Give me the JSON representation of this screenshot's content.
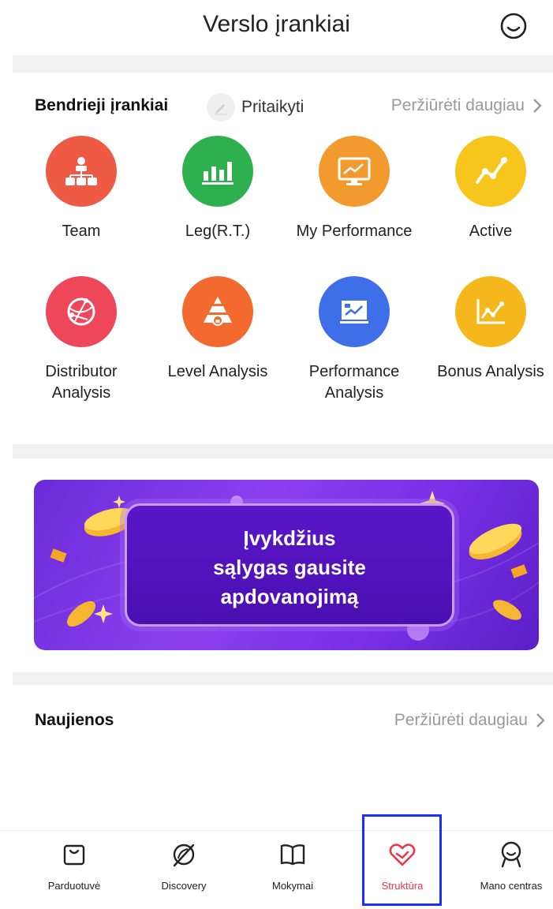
{
  "header": {
    "title": "Verslo įrankiai",
    "chat_icon": "chat-smile-icon"
  },
  "tools_section": {
    "title": "Bendrieji įrankiai",
    "customize_label": "Pritaikyti",
    "see_more_label": "Peržiūrėti daugiau",
    "items": [
      {
        "label": "Team",
        "icon": "team-hierarchy-icon",
        "color": "#ef5a44"
      },
      {
        "label": "Leg(R.T.)",
        "icon": "bar-chart-icon",
        "color": "#2fb04e"
      },
      {
        "label": "My Performance",
        "icon": "monitor-chart-icon",
        "color": "#f29a2e"
      },
      {
        "label": "Active",
        "icon": "line-trend-icon",
        "color": "#f7c51c"
      },
      {
        "label": "Distributor Analysis",
        "icon": "globe-network-icon",
        "color": "#ee4759"
      },
      {
        "label": "Level Analysis",
        "icon": "pyramid-lock-icon",
        "color": "#f26a2e"
      },
      {
        "label": "Performance Analysis",
        "icon": "presentation-chart-icon",
        "color": "#3f6fe8"
      },
      {
        "label": "Bonus Analysis",
        "icon": "bonus-chart-icon",
        "color": "#f5b81c"
      }
    ]
  },
  "banner": {
    "text": "Įvykdžius\nsąlygas gausite\napdovanojimą"
  },
  "news": {
    "title": "Naujienos",
    "see_more_label": "Peržiūrėti daugiau"
  },
  "tabbar": {
    "items": [
      {
        "label": "Parduotuvė",
        "icon": "shopping-bag-icon"
      },
      {
        "label": "Discovery",
        "icon": "discovery-leaf-icon"
      },
      {
        "label": "Mokymai",
        "icon": "book-icon"
      },
      {
        "label": "Struktūra",
        "icon": "structure-heart-icon",
        "active": true
      },
      {
        "label": "Mano centras",
        "icon": "profile-icon"
      }
    ],
    "active_color": "#e53950"
  }
}
